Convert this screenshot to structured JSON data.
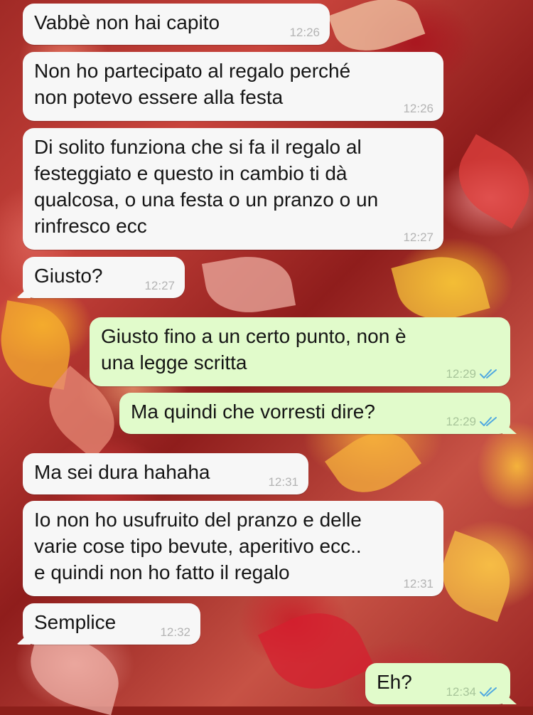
{
  "chat": {
    "wallpaper": "autumn-leaves",
    "colors": {
      "incoming_bubble": "#f7f7f7",
      "outgoing_bubble": "#e1fbcb",
      "read_ticks": "#4fa8e0"
    },
    "messages": [
      {
        "direction": "in",
        "text": "Vabbè non hai capito",
        "time": "12:26"
      },
      {
        "direction": "in",
        "text": "Non ho partecipato al regalo perché\nnon potevo essere alla festa",
        "time": "12:26"
      },
      {
        "direction": "in",
        "text": "Di solito funziona che si fa il regalo al\nfesteggiato e questo in cambio ti dà\nqualcosa, o una festa o un pranzo o un\nrinfresco ecc",
        "time": "12:27"
      },
      {
        "direction": "in",
        "text": "Giusto?",
        "time": "12:27"
      },
      {
        "direction": "out",
        "text": "Giusto fino a un certo punto, non è\nuna legge scritta",
        "time": "12:29",
        "status": "read"
      },
      {
        "direction": "out",
        "text": "Ma quindi che vorresti dire?",
        "time": "12:29",
        "status": "read"
      },
      {
        "direction": "in",
        "text": "Ma sei dura hahaha",
        "time": "12:31"
      },
      {
        "direction": "in",
        "text": "Io non ho usufruito del pranzo e delle\nvarie cose tipo bevute, aperitivo ecc..\ne quindi non ho fatto il regalo",
        "time": "12:31"
      },
      {
        "direction": "in",
        "text": "Semplice",
        "time": "12:32"
      },
      {
        "direction": "out",
        "text": "Eh?",
        "time": "12:34",
        "status": "read"
      }
    ]
  }
}
